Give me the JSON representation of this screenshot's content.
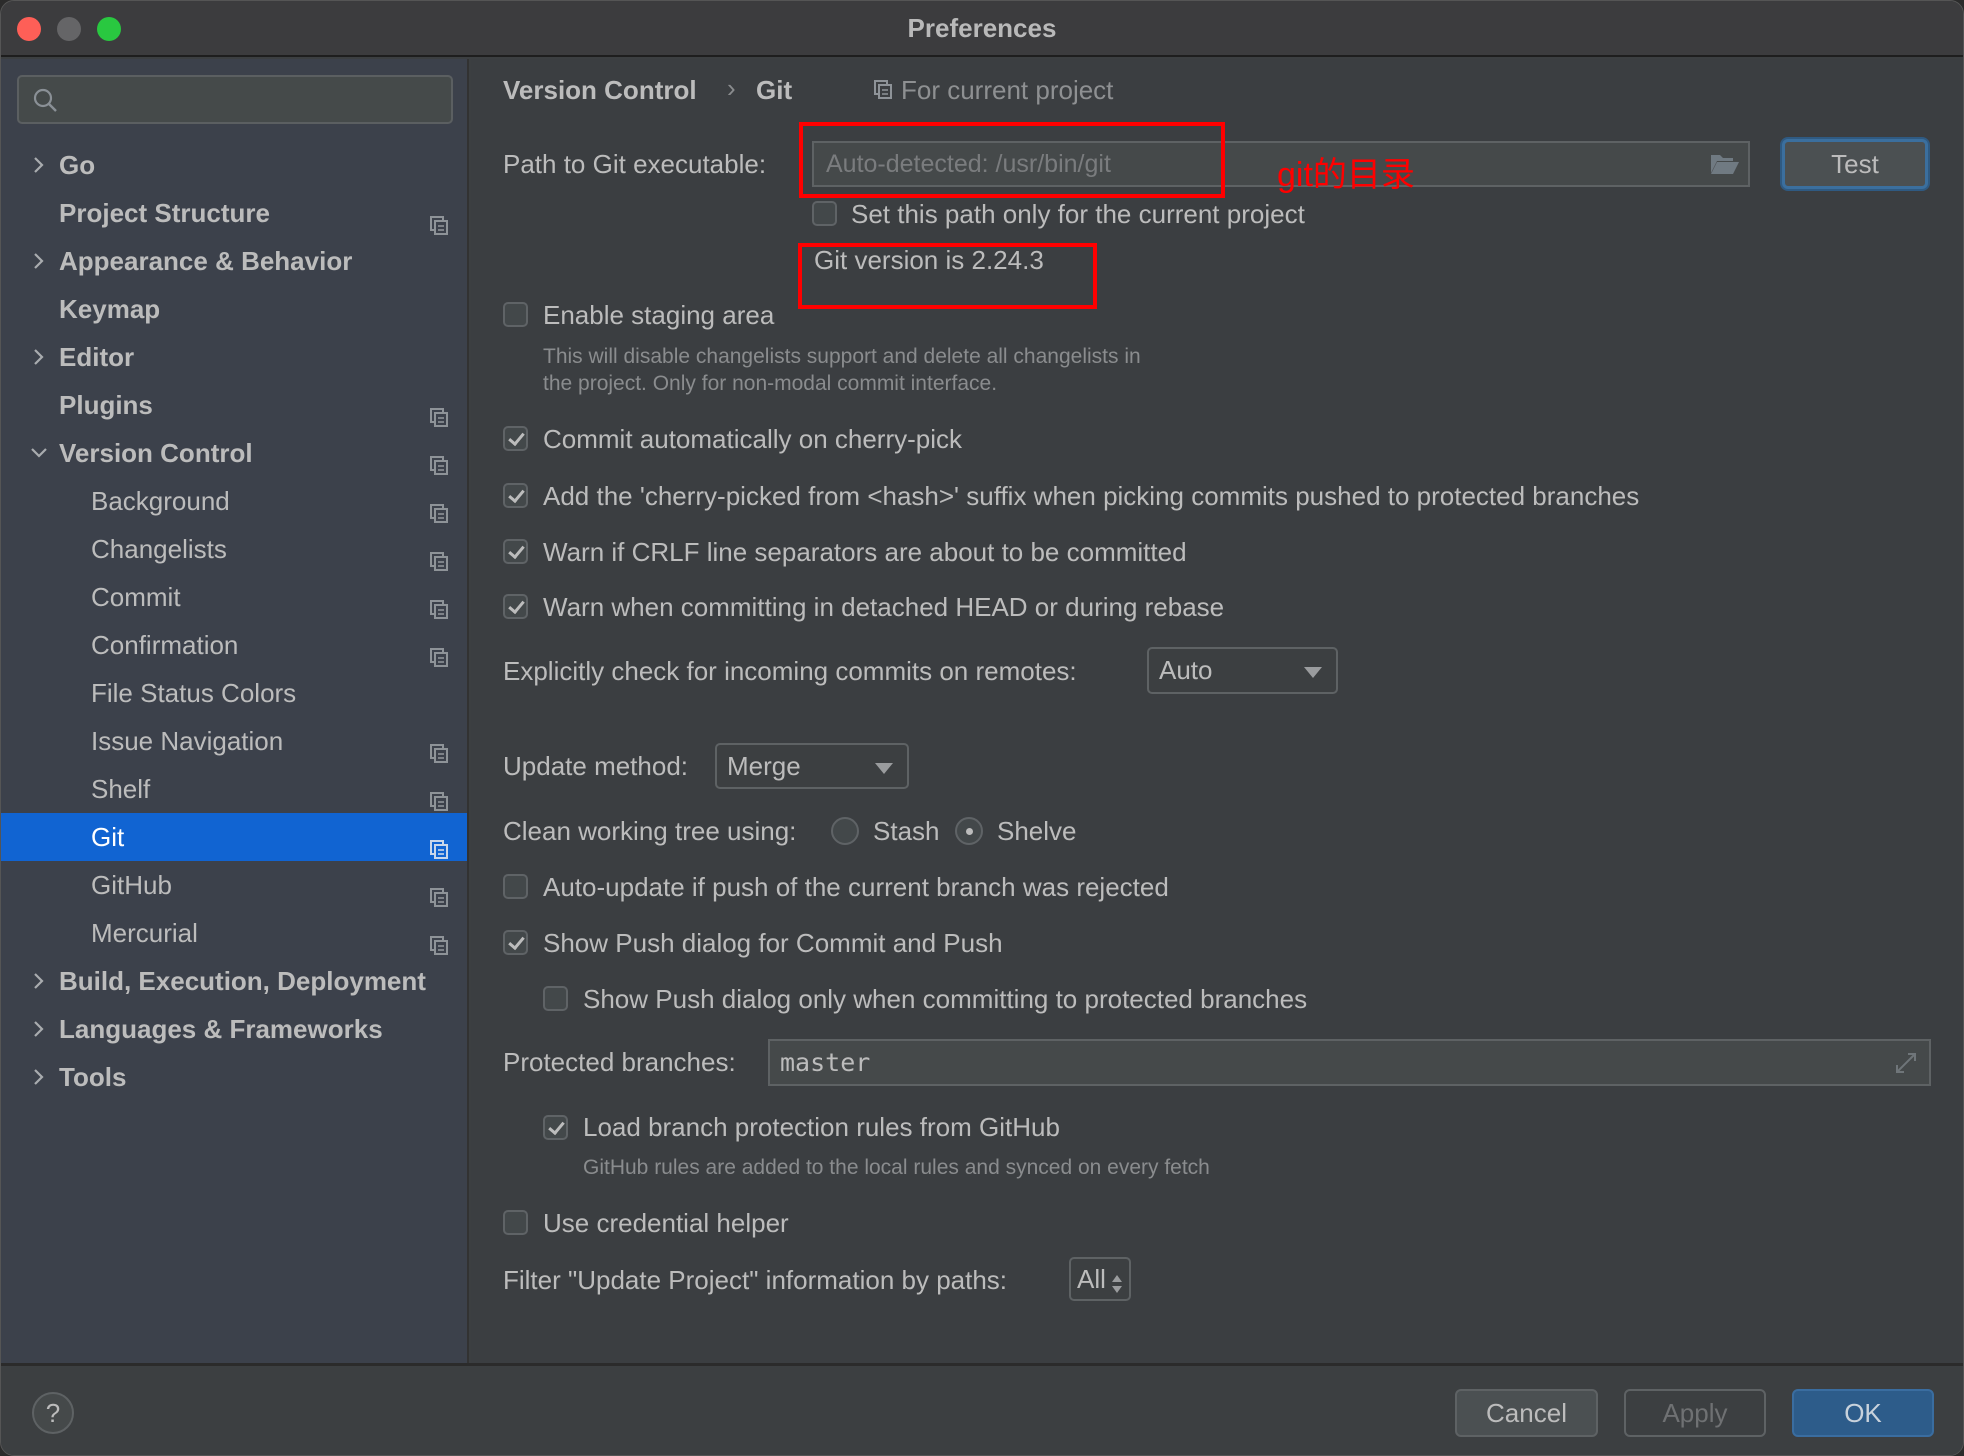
{
  "window": {
    "title": "Preferences"
  },
  "sidebar": {
    "search_placeholder": "",
    "items": [
      {
        "label": "Go",
        "level": 0,
        "arrow": "right",
        "project": false
      },
      {
        "label": "Project Structure",
        "level": 0,
        "arrow": "",
        "project": true
      },
      {
        "label": "Appearance & Behavior",
        "level": 0,
        "arrow": "right",
        "project": false
      },
      {
        "label": "Keymap",
        "level": 0,
        "arrow": "",
        "project": false
      },
      {
        "label": "Editor",
        "level": 0,
        "arrow": "right",
        "project": false
      },
      {
        "label": "Plugins",
        "level": 0,
        "arrow": "",
        "project": true
      },
      {
        "label": "Version Control",
        "level": 0,
        "arrow": "down",
        "project": true
      },
      {
        "label": "Background",
        "level": 1,
        "arrow": "",
        "project": true
      },
      {
        "label": "Changelists",
        "level": 1,
        "arrow": "",
        "project": true
      },
      {
        "label": "Commit",
        "level": 1,
        "arrow": "",
        "project": true
      },
      {
        "label": "Confirmation",
        "level": 1,
        "arrow": "",
        "project": true
      },
      {
        "label": "File Status Colors",
        "level": 1,
        "arrow": "",
        "project": false
      },
      {
        "label": "Issue Navigation",
        "level": 1,
        "arrow": "",
        "project": true
      },
      {
        "label": "Shelf",
        "level": 1,
        "arrow": "",
        "project": true
      },
      {
        "label": "Git",
        "level": 1,
        "arrow": "",
        "project": true,
        "selected": true
      },
      {
        "label": "GitHub",
        "level": 1,
        "arrow": "",
        "project": true
      },
      {
        "label": "Mercurial",
        "level": 1,
        "arrow": "",
        "project": true
      },
      {
        "label": "Build, Execution, Deployment",
        "level": 0,
        "arrow": "right",
        "project": false
      },
      {
        "label": "Languages & Frameworks",
        "level": 0,
        "arrow": "right",
        "project": false
      },
      {
        "label": "Tools",
        "level": 0,
        "arrow": "right",
        "project": false
      }
    ]
  },
  "breadcrumb": {
    "parent": "Version Control",
    "separator": "›",
    "current": "Git",
    "scope": "For current project"
  },
  "git": {
    "path_label": "Path to Git executable:",
    "path_placeholder": "Auto-detected: /usr/bin/git",
    "path_value": "",
    "test_button": "Test",
    "set_path_only": {
      "label": "Set this path only for the current project",
      "checked": false
    },
    "version_text": "Git version is 2.24.3",
    "staging": {
      "label": "Enable staging area",
      "checked": false
    },
    "staging_desc_1": "This will disable changelists support and delete all changelists in",
    "staging_desc_2": "the project. Only for non-modal commit interface.",
    "commit_cherry": {
      "label": "Commit automatically on cherry-pick",
      "checked": true
    },
    "cherry_suffix": {
      "label": "Add the 'cherry-picked from <hash>' suffix when picking commits pushed to protected branches",
      "checked": true
    },
    "warn_crlf": {
      "label": "Warn if CRLF line separators are about to be committed",
      "checked": true
    },
    "warn_detached": {
      "label": "Warn when committing in detached HEAD or during rebase",
      "checked": true
    },
    "incoming_label": "Explicitly check for incoming commits on remotes:",
    "incoming_value": "Auto",
    "update_method_label": "Update method:",
    "update_method_value": "Merge",
    "clean_tree_label": "Clean working tree using:",
    "clean_tree_options": [
      {
        "label": "Stash",
        "selected": false
      },
      {
        "label": "Shelve",
        "selected": true
      }
    ],
    "auto_update": {
      "label": "Auto-update if push of the current branch was rejected",
      "checked": false
    },
    "show_push": {
      "label": "Show Push dialog for Commit and Push",
      "checked": true
    },
    "show_push_protected": {
      "label": "Show Push dialog only when committing to protected branches",
      "checked": false
    },
    "protected_label": "Protected branches:",
    "protected_value": "master",
    "load_rules": {
      "label": "Load branch protection rules from GitHub",
      "checked": true
    },
    "load_rules_desc": "GitHub rules are added to the local rules and synced on every fetch",
    "credential_helper": {
      "label": "Use credential helper",
      "checked": false
    },
    "filter_label": "Filter \"Update Project\" information by paths:",
    "filter_value": "All"
  },
  "annotations": {
    "path_note": "git的目录",
    "color": "#ff0000"
  },
  "footer": {
    "help": "?",
    "cancel": "Cancel",
    "apply": "Apply",
    "ok": "OK"
  },
  "colors": {
    "accent": "#1164d2",
    "ok_button": "#2d5c8a",
    "sidebar_bg": "#3c414b",
    "panel_bg": "#3b3e41"
  }
}
